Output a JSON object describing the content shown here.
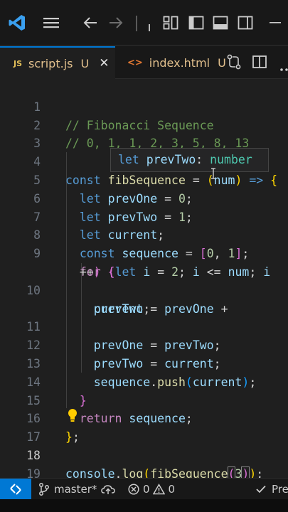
{
  "tabs": [
    {
      "badge": "JS",
      "name": "script.js",
      "status": "U",
      "close": "✕"
    },
    {
      "badge": "<>",
      "name": "index.html",
      "status": "U"
    }
  ],
  "tooltip": {
    "keyword": "let",
    "name": "prevTwo",
    "type": "number"
  },
  "editor": {
    "line_numbers": [
      "1",
      "2",
      "3",
      "4",
      "5",
      "6",
      "7",
      "8",
      "9",
      "10",
      "11",
      "12",
      "13",
      "14",
      "15",
      "16",
      "17",
      "18",
      "19"
    ],
    "comment1": "// Fibonacci Sequence",
    "comment2": "// 0, 1, 1, 2, 3, 5, 8, 13",
    "tokens": {
      "const": "const",
      "let": "let",
      "for": "for",
      "return": "return",
      "fibSequence": "fibSequence",
      "num": "num",
      "prevOne": "prevOne",
      "prevTwo": "prevTwo",
      "current": "current",
      "sequence": "sequence",
      "i": "i",
      "push": "push",
      "console": "console",
      "log": "log",
      "zero": "0",
      "one": "1",
      "two": "2",
      "three": "3"
    }
  },
  "statusbar": {
    "branch": "master*",
    "errors": "0",
    "warnings": "0",
    "right": "Pre"
  },
  "colors": {
    "accent": "#0078d4",
    "background": "#1f1f1f",
    "keyword": "#569cd6",
    "control": "#c586c0",
    "variable": "#9cdcfe",
    "function": "#dcdcaa",
    "number": "#b5cea8",
    "comment": "#6a9955"
  }
}
